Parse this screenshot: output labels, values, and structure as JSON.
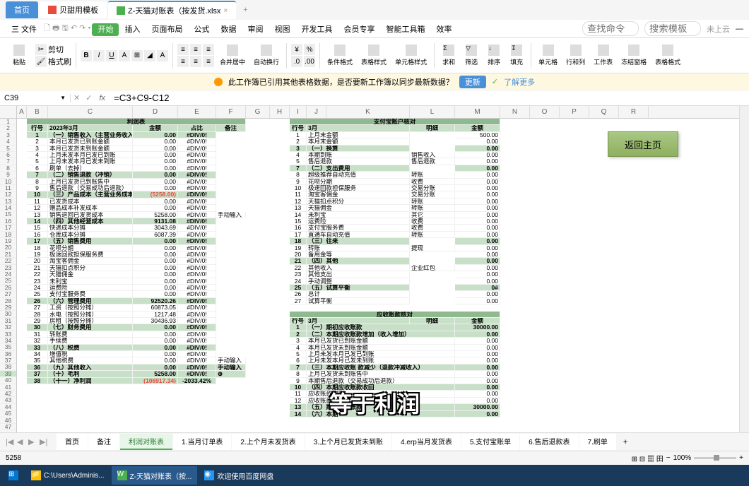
{
  "titleTabs": {
    "home": "首页",
    "doc1": "贝甜用模板",
    "doc2": "Z-天猫对账表（按发货.xlsx"
  },
  "menu": {
    "file": "三 文件",
    "items": [
      "开始",
      "插入",
      "页面布局",
      "公式",
      "数据",
      "审阅",
      "视图",
      "开发工具",
      "会员专享",
      "智能工具箱",
      "效率"
    ],
    "search_ph": "查找命令",
    "search2": "搜索模板",
    "cloud": "未上云"
  },
  "ribbon": {
    "paste": "粘贴",
    "cut": "剪切",
    "format": "格式刷",
    "merge": "合并居中",
    "wrap": "自动换行",
    "cond": "条件格式",
    "style": "表格样式",
    "cellstyle": "单元格样式",
    "sum": "求和",
    "filter": "筛选",
    "sort": "排序",
    "fill": "填充",
    "cell": "单元格",
    "rowcol": "行和列",
    "sheet": "工作表",
    "freeze": "冻结窗格",
    "tblfmt": "表格格式"
  },
  "warning": {
    "text": "此工作簿已引用其他表格数据，是否要新工作簿以同步最新数据？",
    "update": "更新",
    "more": "了解更多"
  },
  "formula": {
    "cell": "C39",
    "fx": "fx",
    "value": "=C3+C9-C12"
  },
  "colWidths": {
    "A": 14,
    "B": 30,
    "C": 120,
    "D": 64,
    "E": 54,
    "F": 42,
    "G": 34,
    "H": 28,
    "I": 24,
    "J": 28,
    "K": 118,
    "L": 64,
    "M": 64,
    "N": 42,
    "O": 42,
    "P": 42,
    "Q": 42,
    "R": 42
  },
  "cols": [
    "A",
    "B",
    "C",
    "D",
    "E",
    "F",
    "G",
    "H",
    "I",
    "J",
    "K",
    "L",
    "M",
    "N",
    "O",
    "P",
    "Q",
    "R"
  ],
  "profit": {
    "title": "利润表",
    "header": {
      "no": "行号",
      "period": "2023年3月",
      "amount": "金额",
      "ratio": "占比",
      "note": "备注"
    },
    "rows": [
      {
        "n": "1",
        "name": "（一）销售收入（主营业务收入）",
        "amt": "0.00",
        "ratio": "#DIV/0!",
        "hdr": true
      },
      {
        "n": "2",
        "name": "本月已发货已到账金额",
        "amt": "0.00",
        "ratio": "#DIV/0!"
      },
      {
        "n": "3",
        "name": "本月已发货未到账金额",
        "amt": "0.00",
        "ratio": "#DIV/0!"
      },
      {
        "n": "4",
        "name": "上月未发本月已发已到账",
        "amt": "0.00",
        "ratio": "#DIV/0!"
      },
      {
        "n": "5",
        "name": "上月未发本月已发未到账",
        "amt": "0.00",
        "ratio": "#DIV/0!"
      },
      {
        "n": "6",
        "name": "刷单（去掉）",
        "amt": "0.00",
        "ratio": "#DIV/0!"
      },
      {
        "n": "7",
        "name": "（二）销售退款（冲销）",
        "amt": "0.00",
        "ratio": "#DIV/0!",
        "hdr": true
      },
      {
        "n": "8",
        "name": "上月已发货已到账售中",
        "amt": "0.00",
        "ratio": "#DIV/0!"
      },
      {
        "n": "9",
        "name": "售后退款（交易成功后退款）",
        "amt": "0.00",
        "ratio": "#DIV/0!"
      },
      {
        "n": "10",
        "name": "（三）产品成本（主营业务成本）",
        "amt": "(5258.00)",
        "ratio": "#DIV/0!",
        "hdr": true,
        "red": true
      },
      {
        "n": "11",
        "name": "已发货成本",
        "amt": "0.00",
        "ratio": "#DIV/0!"
      },
      {
        "n": "12",
        "name": "赠品成本补发成本",
        "amt": "0.00",
        "ratio": "#DIV/0!"
      },
      {
        "n": "13",
        "name": "销售退回已发货成本",
        "amt": "5258.00",
        "ratio": "#DIV/0!",
        "note": "手动输入"
      },
      {
        "n": "14",
        "name": "（四）其他经营成本",
        "amt": "9131.08",
        "ratio": "#DIV/0!",
        "hdr": true
      },
      {
        "n": "15",
        "name": "快递成本分摊",
        "amt": "3043.69",
        "ratio": "#DIV/0!"
      },
      {
        "n": "16",
        "name": "仓库成本分摊",
        "amt": "6087.39",
        "ratio": "#DIV/0!"
      },
      {
        "n": "17",
        "name": "（五）销售费用",
        "amt": "0.00",
        "ratio": "#DIV/0!",
        "hdr": true
      },
      {
        "n": "18",
        "name": "花呗分期",
        "amt": "0.00",
        "ratio": "#DIV/0!"
      },
      {
        "n": "19",
        "name": "极速回款担保服务费",
        "amt": "0.00",
        "ratio": "#DIV/0!"
      },
      {
        "n": "20",
        "name": "淘宝客佣金",
        "amt": "0.00",
        "ratio": "#DIV/0!"
      },
      {
        "n": "21",
        "name": "天猫扣点积分",
        "amt": "0.00",
        "ratio": "#DIV/0!"
      },
      {
        "n": "22",
        "name": "天猫佣金",
        "amt": "0.00",
        "ratio": "#DIV/0!"
      },
      {
        "n": "23",
        "name": "未利宝",
        "amt": "0.00",
        "ratio": "#DIV/0!"
      },
      {
        "n": "24",
        "name": "运费险",
        "amt": "0.00",
        "ratio": "#DIV/0!"
      },
      {
        "n": "25",
        "name": "支付宝服务费",
        "amt": "0.00",
        "ratio": "#DIV/0!"
      },
      {
        "n": "26",
        "name": "（六）管理费用",
        "amt": "92520.26",
        "ratio": "#DIV/0!",
        "hdr": true
      },
      {
        "n": "27",
        "name": "工资（按照分摊）",
        "amt": "60873.05",
        "ratio": "#DIV/0!"
      },
      {
        "n": "28",
        "name": "水电（按照分摊）",
        "amt": "1217.48",
        "ratio": "#DIV/0!"
      },
      {
        "n": "29",
        "name": "房租（按照分摊）",
        "amt": "30436.93",
        "ratio": "#DIV/0!"
      },
      {
        "n": "30",
        "name": "（七）财务费用",
        "amt": "0.00",
        "ratio": "#DIV/0!",
        "hdr": true
      },
      {
        "n": "31",
        "name": "转账费",
        "amt": "0.00",
        "ratio": "#DIV/0!"
      },
      {
        "n": "32",
        "name": "手续费",
        "amt": "0.00",
        "ratio": "#DIV/0!"
      },
      {
        "n": "33",
        "name": "（八）税费",
        "amt": "0.00",
        "ratio": "#DIV/0!",
        "hdr": true
      },
      {
        "n": "34",
        "name": "增值税",
        "amt": "0.00",
        "ratio": "#DIV/0!"
      },
      {
        "n": "35",
        "name": "其他税费",
        "amt": "0.00",
        "ratio": "#DIV/0!",
        "note": "手动输入"
      },
      {
        "n": "36",
        "name": "（九）其他收入",
        "amt": "0.00",
        "ratio": "#DIV/0!",
        "note": "手动输入",
        "hdr": true
      },
      {
        "n": "37",
        "name": "（十）毛利",
        "amt": "5258.00",
        "ratio": "#DIV/0!",
        "hdr": true,
        "sel": true,
        "note": "⊕"
      },
      {
        "n": "38",
        "name": "（十一）净利润",
        "amt": "(106917.34)",
        "ratio": "-2033.42%",
        "hdr": true,
        "red": true
      }
    ]
  },
  "alipay": {
    "title": "支付宝账户核对",
    "header": {
      "no": "行号",
      "period": "3月",
      "detail": "明细",
      "amt": "金额"
    },
    "rows": [
      {
        "n": "1",
        "name": "上月末金额",
        "amt": "500.00"
      },
      {
        "n": "2",
        "name": "本月末金额",
        "amt": "0.00"
      },
      {
        "n": "3",
        "name": "（一）换算",
        "hdr": true,
        "amt": "0.00"
      },
      {
        "n": "4",
        "name": "本期到账",
        "d": "销售收入",
        "amt": "0.00"
      },
      {
        "n": "5",
        "name": "售后退款",
        "d": "售后退款",
        "amt": "0.00"
      },
      {
        "n": "7",
        "name": "（二）支出费用",
        "hdr": true,
        "amt": "0.00"
      },
      {
        "n": "8",
        "name": "超级推荐自动充值",
        "d": "转账",
        "amt": "0.00"
      },
      {
        "n": "9",
        "name": "花呗分期",
        "d": "收费",
        "amt": "0.00"
      },
      {
        "n": "10",
        "name": "极速回款担保服务",
        "d": "交易分账",
        "amt": "0.00"
      },
      {
        "n": "11",
        "name": "淘宝客佣金",
        "d": "交易分账",
        "amt": "0.00"
      },
      {
        "n": "12",
        "name": "天猫扣点积分",
        "d": "转账",
        "amt": "0.00"
      },
      {
        "n": "13",
        "name": "天猫佣金",
        "d": "转账",
        "amt": "0.00"
      },
      {
        "n": "14",
        "name": "未利宝",
        "d": "其它",
        "amt": "0.00"
      },
      {
        "n": "15",
        "name": "运费险",
        "d": "收费",
        "amt": "0.00"
      },
      {
        "n": "16",
        "name": "支付宝服务费",
        "d": "收费",
        "amt": "0.00"
      },
      {
        "n": "17",
        "name": "直通车自动充值",
        "d": "转账",
        "amt": "0.00"
      },
      {
        "n": "18",
        "name": "（三）往来",
        "hdr": true,
        "amt": "0.00"
      },
      {
        "n": "19",
        "name": "转账",
        "d": "提现",
        "amt": "0.00"
      },
      {
        "n": "20",
        "name": "备用金等",
        "amt": "0.00"
      },
      {
        "n": "21",
        "name": "（四）其他",
        "hdr": true,
        "amt": "0.00"
      },
      {
        "n": "22",
        "name": "其他收入",
        "d": "企业红包",
        "amt": "0.00"
      },
      {
        "n": "23",
        "name": "其他支出",
        "amt": "0.00"
      },
      {
        "n": "24",
        "name": "手动调整",
        "amt": "0.00"
      },
      {
        "n": "25",
        "name": "（五）试算平衡",
        "hdr": true,
        "amt": "0#"
      },
      {
        "n": "26",
        "name": "总计",
        "amt": "0.00"
      },
      {
        "n": "27",
        "name": "试算平衡",
        "amt": "0.00"
      }
    ]
  },
  "ar": {
    "title": "应收账款核对",
    "header": {
      "no": "行号",
      "period": "3月",
      "detail": "明细",
      "amt": "金额"
    },
    "rows": [
      {
        "n": "1",
        "name": "（一）期初应收账款",
        "hdr": true,
        "amt": "30000.00"
      },
      {
        "n": "2",
        "name": "（二）本期应收账款增加（收入增加）",
        "hdr": true,
        "amt": "0.00"
      },
      {
        "n": "3",
        "name": "本月已发货已到账金额",
        "amt": "0.00"
      },
      {
        "n": "4",
        "name": "本月已发货未到账金额",
        "amt": "0.00"
      },
      {
        "n": "5",
        "name": "上月未发本月已发已到账",
        "amt": "0.00"
      },
      {
        "n": "6",
        "name": "上月未发本月已发未到账",
        "amt": "0.00"
      },
      {
        "n": "7",
        "name": "（三）本期应收账 款减少（退款冲减收入）",
        "hdr": true,
        "amt": "0.00"
      },
      {
        "n": "8",
        "name": "上月已发货未到账售中",
        "amt": "0.00"
      },
      {
        "n": "9",
        "name": "本期售后退款（交易成功后退款）",
        "amt": "0.00"
      },
      {
        "n": "10",
        "name": "（四）本期应收账款收回",
        "hdr": true,
        "amt": "0.00"
      },
      {
        "n": "11",
        "name": "应收账款到账",
        "amt": "0.00"
      },
      {
        "n": "12",
        "name": "应收账款退回",
        "amt": "0.00"
      },
      {
        "n": "13",
        "name": "（五）期末应收账款",
        "hdr": true,
        "amt": "30000.00"
      },
      {
        "n": "14",
        "name": "（六）本期",
        "hdr": true,
        "amt": "0.00"
      }
    ]
  },
  "returnBtn": "返回主页",
  "sheets": [
    "首页",
    "备注",
    "利润对账表",
    "1.当月订单表",
    "2.上个月未发货表",
    "3.上个月已发货未到账",
    "4.erp当月发货表",
    "5.支付宝账单",
    "6.售后退款表",
    "7.刷单"
  ],
  "activeSheet": 2,
  "status": {
    "value": "5258",
    "zoom": "100%"
  },
  "taskbar": {
    "path": "C:\\Users\\Adminis...",
    "app1": "Z-天猫对账表（按...",
    "app2": "欢迎使用百度网盘"
  },
  "overlay": "等于利润"
}
